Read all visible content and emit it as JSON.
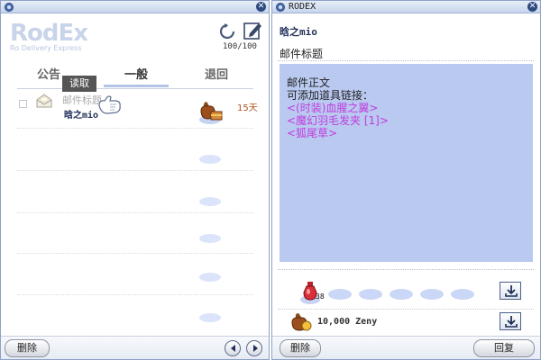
{
  "left_window": {
    "logo": {
      "main": "RodEx",
      "sub": "Ro Delivery Express"
    },
    "mail_count": "100/100",
    "tabs": [
      {
        "label": "公告"
      },
      {
        "label": "一般"
      },
      {
        "label": "退回"
      }
    ],
    "tooltip": "读取",
    "mail": {
      "subject": "邮件标题",
      "sender": "晗之mio",
      "days_left": "15天"
    },
    "delete_label": "删除",
    "icons": {
      "refresh": "refresh-icon",
      "compose": "compose-icon",
      "prev": "prev-page-icon",
      "next": "next-page-icon"
    }
  },
  "right_window": {
    "title": "RODEX",
    "sender": "晗之mio",
    "mail_title": "邮件标题",
    "body_lines": [
      {
        "text": "邮件正文",
        "kind": "plain"
      },
      {
        "text": "可添加道具链接：",
        "kind": "plain"
      },
      {
        "text": "<(时装)血腥之翼>",
        "kind": "link"
      },
      {
        "text": "<魔幻羽毛发夹 [1]>",
        "kind": "link"
      },
      {
        "text": "<狐尾草>",
        "kind": "link"
      }
    ],
    "attachment_qty": "38",
    "zeny": "10,000 Zeny",
    "delete_label": "删除",
    "reply_label": "回复"
  },
  "colors": {
    "body_bg": "#b9c9f0",
    "link": "#c13be0",
    "accent": "#b3c3e6"
  }
}
